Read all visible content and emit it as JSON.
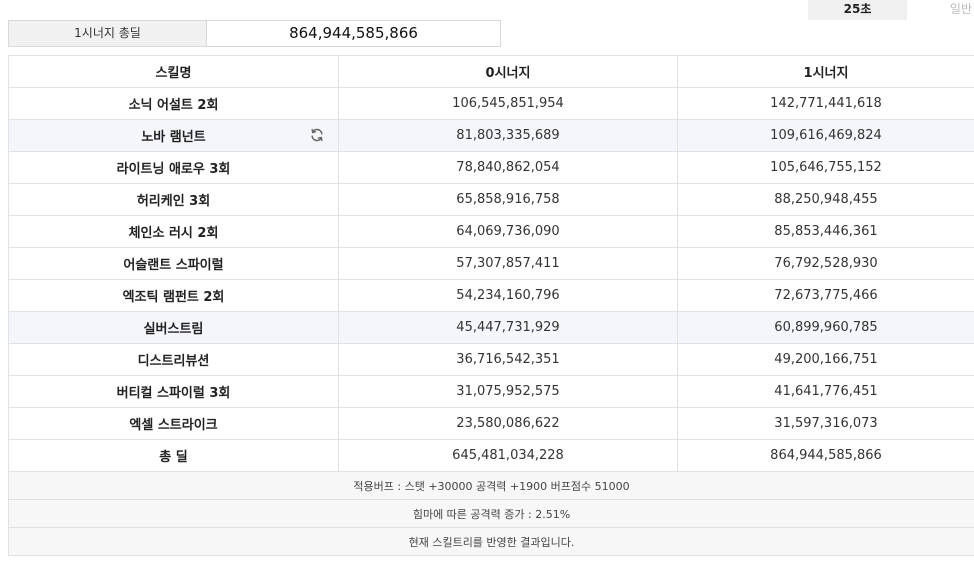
{
  "tabs": [
    {
      "label": "25초",
      "active": true
    },
    {
      "label": "일반",
      "active": false
    }
  ],
  "summary": {
    "label": "1시너지 총딜",
    "value": "864,944,585,866"
  },
  "table": {
    "headers": [
      "스킬명",
      "0시너지",
      "1시너지"
    ],
    "rows": [
      {
        "name": "소닉 어설트 2회",
        "v0": "106,545,851,954",
        "v1": "142,771,441,618"
      },
      {
        "name": "노바 램넌트",
        "v0": "81,803,335,689",
        "v1": "109,616,469,824"
      },
      {
        "name": "라이트닝 애로우 3회",
        "v0": "78,840,862,054",
        "v1": "105,646,755,152"
      },
      {
        "name": "허리케인 3회",
        "v0": "65,858,916,758",
        "v1": "88,250,948,455"
      },
      {
        "name": "체인소 러시 2회",
        "v0": "64,069,736,090",
        "v1": "85,853,446,361"
      },
      {
        "name": "어슬랜트 스파이럴",
        "v0": "57,307,857,411",
        "v1": "76,792,528,930"
      },
      {
        "name": "엑조틱 램펀트 2회",
        "v0": "54,234,160,796",
        "v1": "72,673,775,466"
      },
      {
        "name": "실버스트림",
        "v0": "45,447,731,929",
        "v1": "60,899,960,785"
      },
      {
        "name": "디스트리뷰션",
        "v0": "36,716,542,351",
        "v1": "49,200,166,751"
      },
      {
        "name": "버티컬 스파이럴 3회",
        "v0": "31,075,952,575",
        "v1": "41,641,776,451"
      },
      {
        "name": "엑셀 스트라이크",
        "v0": "23,580,086,622",
        "v1": "31,597,316,073"
      }
    ],
    "total": {
      "name": "총 딜",
      "v0": "645,481,034,228",
      "v1": "864,944,585,866"
    }
  },
  "notes": [
    "적용버프 : 스탯 +30000 공격력 +1900 버프점수 51000",
    "힘마에 따른 공격력 증가 : 2.51%",
    "현재 스킬트리를 반영한 결과입니다."
  ],
  "icons": {
    "refresh": "refresh-icon"
  }
}
